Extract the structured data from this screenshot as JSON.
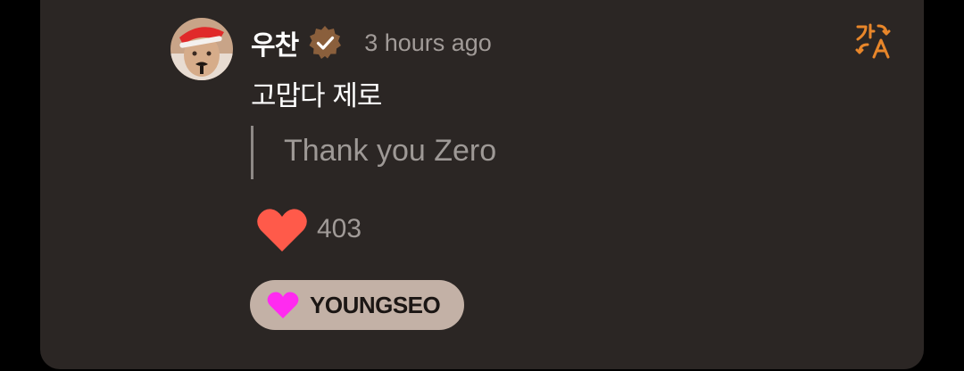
{
  "comment": {
    "author": {
      "name": "우찬",
      "verified": true,
      "avatar_icon": "profile-photo-santa-hat"
    },
    "time": "3 hours ago",
    "text": "고맙다 제로",
    "translation": "Thank you Zero",
    "likes": "403",
    "tag": "YOUNGSEO",
    "translate_icon": "translate-icon"
  },
  "colors": {
    "card_bg": "#2b2624",
    "accent_orange": "#e8862a",
    "heart_red": "#ff5a4a",
    "tag_heart": "#ff2bf0",
    "tag_bg": "#c3b1a6",
    "verified_badge": "#8a5f3c"
  }
}
